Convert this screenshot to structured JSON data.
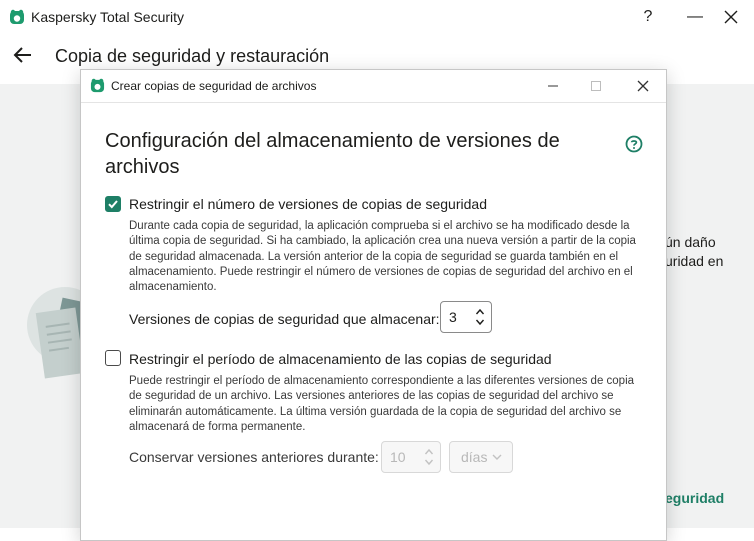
{
  "main_window": {
    "app_title": "Kaspersky Total Security",
    "help_label": "?",
    "minimize_label": "—",
    "page_title": "Copia de seguridad y restauración",
    "background_text_1": "ún daño",
    "background_text_2": "uridad en",
    "background_link": "eguridad"
  },
  "dialog": {
    "title": "Crear copias de seguridad de archivos",
    "heading": "Configuración del almacenamiento de versiones de archivos",
    "option_versions": {
      "checked": true,
      "label": "Restringir el número de versiones de copias de seguridad",
      "description": "Durante cada copia de seguridad, la aplicación comprueba si el archivo se ha modificado desde la última copia de seguridad. Si ha cambiado, la aplicación crea una nueva versión a partir de la copia de seguridad almacenada. La versión anterior de la copia de seguridad se guarda también en el almacenamiento. Puede restringir el número de versiones de copias de seguridad del archivo en el almacenamiento.",
      "field_label": "Versiones de copias de seguridad que almacenar:",
      "field_value": "3"
    },
    "option_period": {
      "checked": false,
      "label": "Restringir el período de almacenamiento de las copias de seguridad",
      "description": "Puede restringir el período de almacenamiento correspondiente a las diferentes versiones de copia de seguridad de un archivo. Las versiones anteriores de las copias de seguridad del archivo se eliminarán automáticamente. La última versión guardada de la copia de seguridad del archivo se almacenará de forma permanente.",
      "field_label": "Conservar versiones anteriores durante:",
      "field_value": "10",
      "unit_value": "días"
    }
  },
  "colors": {
    "accent": "#1e7f66",
    "background": "#f1f2f2"
  }
}
